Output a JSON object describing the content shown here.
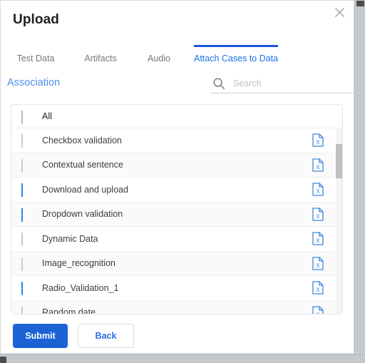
{
  "dialog": {
    "title": "Upload",
    "close_icon": "close-icon"
  },
  "tabs": [
    {
      "label": "Test Data",
      "active": false
    },
    {
      "label": "Artifacts",
      "active": false
    },
    {
      "label": "Audio",
      "active": false
    },
    {
      "label": "Attach Cases to Data",
      "active": true
    }
  ],
  "association": {
    "label": "Association"
  },
  "search": {
    "icon": "search-icon",
    "placeholder": "Search",
    "value": ""
  },
  "list": {
    "select_all": {
      "label": "All",
      "state": "indeterminate"
    },
    "items": [
      {
        "label": "Checkbox validation",
        "checked": false,
        "file_icon": "excel-file-icon"
      },
      {
        "label": "Contextual sentence",
        "checked": false,
        "file_icon": "excel-file-icon"
      },
      {
        "label": "Download and upload",
        "checked": true,
        "file_icon": "excel-file-icon"
      },
      {
        "label": "Dropdown validation",
        "checked": true,
        "file_icon": "excel-file-icon"
      },
      {
        "label": "Dynamic Data",
        "checked": false,
        "file_icon": "excel-file-icon"
      },
      {
        "label": "Image_recognition",
        "checked": false,
        "file_icon": "excel-file-icon"
      },
      {
        "label": "Radio_Validation_1",
        "checked": true,
        "file_icon": "excel-file-icon"
      },
      {
        "label": "Random date",
        "checked": false,
        "file_icon": "excel-file-icon"
      }
    ]
  },
  "footer": {
    "submit_label": "Submit",
    "back_label": "Back"
  },
  "colors": {
    "accent_blue": "#1a62d6",
    "tab_active_blue": "#1a73e8",
    "checkbox_blue": "#2a85f0",
    "association_blue": "#4e8ef0",
    "excel_icon_blue": "#3b86e0",
    "muted_text": "#77787b"
  }
}
